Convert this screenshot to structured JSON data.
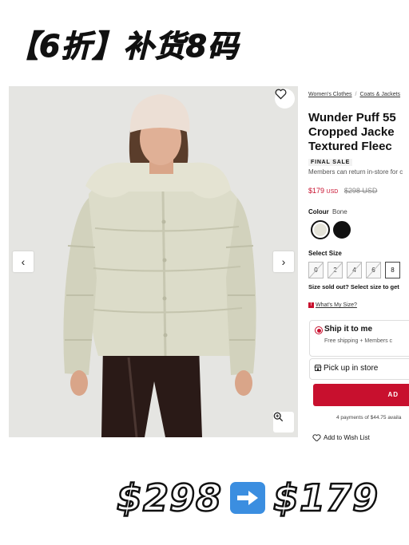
{
  "banner": {
    "text": "【6折】补货8码"
  },
  "product_image": {
    "prev_label": "‹",
    "next_label": "›",
    "wishlist_icon": "heart-outline-icon",
    "zoom_icon": "zoom-in-icon"
  },
  "breadcrumb": [
    {
      "label": "Women's Clothes"
    },
    {
      "label": "Coats & Jackets"
    }
  ],
  "product": {
    "title_lines": [
      "Wunder Puff 55",
      "Cropped Jacke",
      "Textured Fleec"
    ],
    "badge": "FINAL SALE",
    "returns_note": "Members can return in-store for c",
    "price": "$179",
    "currency": "USD",
    "old_price": "$298 USD"
  },
  "colour": {
    "label": "Colour",
    "selected": "Bone",
    "swatches": [
      {
        "name": "Bone",
        "hex": "#e4e3d8"
      },
      {
        "name": "Black",
        "hex": "#111111"
      }
    ]
  },
  "sizes": {
    "label": "Select Size",
    "options": [
      {
        "label": "0",
        "available": false
      },
      {
        "label": "2",
        "available": false
      },
      {
        "label": "4",
        "available": false
      },
      {
        "label": "6",
        "available": false
      },
      {
        "label": "8",
        "available": true
      }
    ],
    "sold_out_note": "Size sold out? Select size to get",
    "whats_my_size": "What's My Size?"
  },
  "delivery": {
    "ship_title": "Ship it to me",
    "ship_sub": "Free shipping + Members c",
    "pickup": "Pick up in store"
  },
  "cart": {
    "button": "AD",
    "payments": "4 payments of $44.75 availa",
    "wishlist": "Add to Wish List"
  },
  "overlay_price": {
    "from": "$298",
    "to": "$179",
    "arrow_icon": "right-arrow-emoji-icon"
  },
  "colors": {
    "accent": "#c8102e",
    "arrow_blue": "#3b8ee0"
  }
}
